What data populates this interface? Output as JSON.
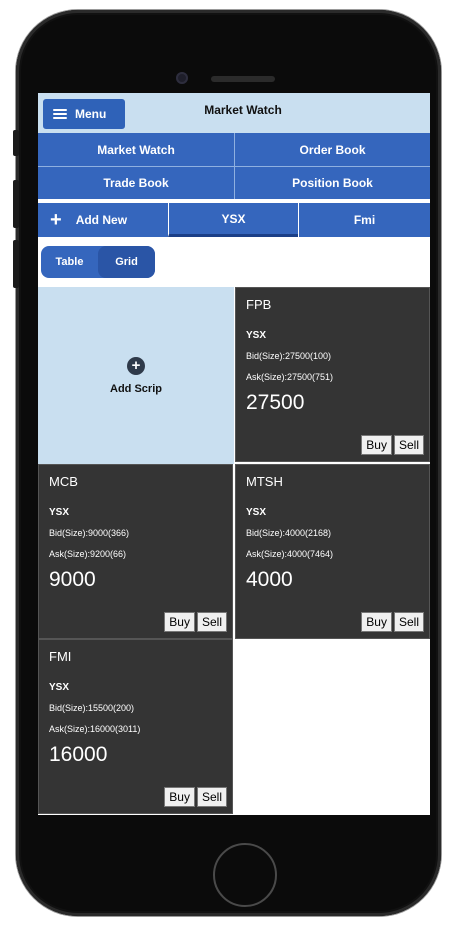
{
  "header": {
    "menu_label": "Menu",
    "title": "Market Watch"
  },
  "nav": {
    "items": [
      "Market Watch",
      "Order Book",
      "Trade Book",
      "Position Book"
    ]
  },
  "exchange_tabs": {
    "add_new": "Add New",
    "tabs": [
      "YSX",
      "Fmi"
    ],
    "active": "YSX"
  },
  "view_toggle": {
    "options": [
      "Table",
      "Grid"
    ],
    "active": "Grid"
  },
  "add_scrip": {
    "label": "Add Scrip"
  },
  "cards": [
    {
      "symbol": "FPB",
      "exchange": "YSX",
      "bid": "Bid(Size):27500(100)",
      "ask": "Ask(Size):27500(751)",
      "price": "27500",
      "buy": "Buy",
      "sell": "Sell"
    },
    {
      "symbol": "MCB",
      "exchange": "YSX",
      "bid": "Bid(Size):9000(366)",
      "ask": "Ask(Size):9200(66)",
      "price": "9000",
      "buy": "Buy",
      "sell": "Sell"
    },
    {
      "symbol": "MTSH",
      "exchange": "YSX",
      "bid": "Bid(Size):4000(2168)",
      "ask": "Ask(Size):4000(7464)",
      "price": "4000",
      "buy": "Buy",
      "sell": "Sell"
    },
    {
      "symbol": "FMI",
      "exchange": "YSX",
      "bid": "Bid(Size):15500(200)",
      "ask": "Ask(Size):16000(3011)",
      "price": "16000",
      "buy": "Buy",
      "sell": "Sell"
    }
  ],
  "colors": {
    "primary": "#3566bd",
    "header_bg": "#c9dff0",
    "card_bg": "#343434"
  }
}
